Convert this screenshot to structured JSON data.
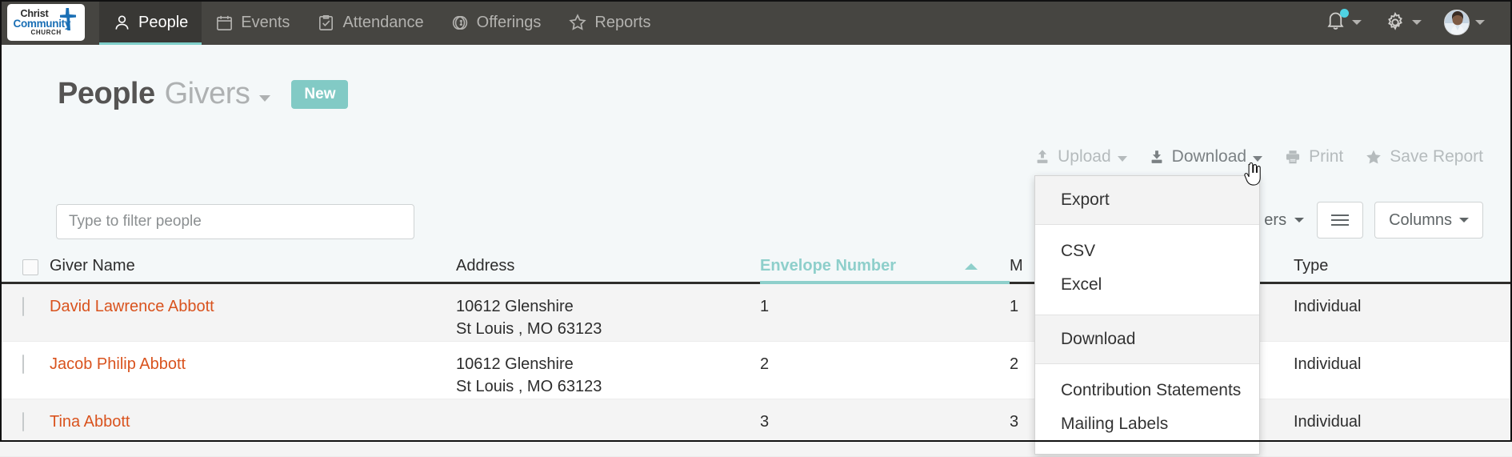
{
  "brand": {
    "logo_line1": "Christ",
    "logo_line2": "Community",
    "logo_line3": "CHURCH",
    "logo_color_primary": "#1a6fb5",
    "logo_color_text": "#2b2b2b"
  },
  "topnav": {
    "items": [
      {
        "label": "People",
        "icon": "person-icon",
        "active": true
      },
      {
        "label": "Events",
        "icon": "calendar-icon",
        "active": false
      },
      {
        "label": "Attendance",
        "icon": "checklist-icon",
        "active": false
      },
      {
        "label": "Offerings",
        "icon": "coin-icon",
        "active": false
      },
      {
        "label": "Reports",
        "icon": "star-icon",
        "active": false
      }
    ],
    "right": {
      "notifications_icon": "bell-icon",
      "notification_dot": true,
      "settings_icon": "gear-icon",
      "avatar_icon": "user-avatar",
      "accent": "#7fcfca",
      "dot_color": "#4fd2e2"
    }
  },
  "header": {
    "title": "People",
    "subtitle": "Givers",
    "new_label": "New",
    "new_color": "#82cac5"
  },
  "search": {
    "placeholder": "Type to filter people",
    "value": ""
  },
  "actions": [
    {
      "label": "Upload",
      "icon": "upload-icon",
      "caret": true,
      "state": "dim"
    },
    {
      "label": "Download",
      "icon": "download-icon",
      "caret": true,
      "state": "hot"
    },
    {
      "label": "Print",
      "icon": "printer-icon",
      "caret": false,
      "state": "dim"
    },
    {
      "label": "Save Report",
      "icon": "star-icon",
      "caret": false,
      "state": "dim"
    }
  ],
  "right_controls": {
    "filters_label": "ers",
    "list_icon": "hamburger-icon",
    "columns_label": "Columns"
  },
  "download_menu": {
    "export_header": "Export",
    "export_items": [
      "CSV",
      "Excel"
    ],
    "download_header": "Download",
    "download_items": [
      "Contribution Statements",
      "Mailing Labels"
    ]
  },
  "table": {
    "columns": [
      {
        "key": "check",
        "label": "",
        "sorted": false
      },
      {
        "key": "name",
        "label": "Giver Name",
        "sorted": false
      },
      {
        "key": "addr",
        "label": "Address",
        "sorted": false
      },
      {
        "key": "env",
        "label": "Envelope Number",
        "sorted": true,
        "direction": "asc",
        "color": "#8ecfcb"
      },
      {
        "key": "member",
        "label": "M",
        "sorted": false
      },
      {
        "key": "type",
        "label": "Type",
        "sorted": false
      }
    ],
    "rows": [
      {
        "name": "David Lawrence Abbott",
        "address_line1": "10612 Glenshire",
        "address_line2": "St Louis , MO   63123",
        "envelope_number": "1",
        "member_number": "1",
        "type": "Individual",
        "shade": "alt"
      },
      {
        "name": "Jacob Philip Abbott",
        "address_line1": "10612 Glenshire",
        "address_line2": "St Louis , MO   63123",
        "envelope_number": "2",
        "member_number": "2",
        "type": "Individual",
        "shade": "white"
      },
      {
        "name": "Tina Abbott",
        "address_line1": "",
        "address_line2": "",
        "envelope_number": "3",
        "member_number": "3",
        "type": "Individual",
        "shade": "alt"
      }
    ]
  },
  "colors": {
    "topbar_bg": "#464541",
    "page_bg": "#f4f8f9",
    "link": "#d9531e",
    "teal": "#8ecfcb"
  }
}
